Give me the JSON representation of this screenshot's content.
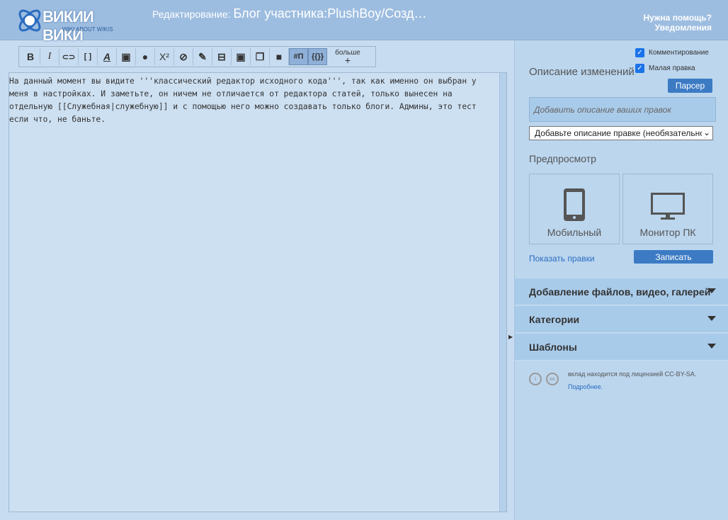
{
  "header": {
    "logo_text": "ВИКИИ ВИКИ",
    "logo_sub": "WIKI ABOUT WIKIS",
    "title_prefix": "Редактирование:",
    "title": "Блог участника:PlushBoy/Созд…",
    "help": "Нужна помощь?",
    "notifications": "Уведомления"
  },
  "toolbar": {
    "bold": "B",
    "italic": "I",
    "link": "⊂⊃",
    "brackets": "[ ]",
    "underline": "A",
    "image": "▣",
    "play": "●",
    "sup": "X²",
    "nowiki": "⊘",
    "sign": "✎",
    "hr": "⊟",
    "gallery_add": "▣",
    "gallery": "❐",
    "video": "■",
    "heading": "#П",
    "template": "{{}}",
    "more": "больше",
    "plus": "+"
  },
  "editor": {
    "content": "На данный момент вы видите '''классический редактор исходного кода''', так как именно он выбран у меня в настройках. И заметьте, он ничем не отличается от редактора статей, только вынесен на отдельную [[Служебная|служебную]] и с помощью него можно создавать только блоги. Админы, это тест если что, не баньте."
  },
  "right": {
    "comment_label": "Комментирование",
    "minor_label": "Малая правка",
    "summary_title": "Описание изменений",
    "parser": "Парсер",
    "summary_placeholder": "Добавить описание ваших правок",
    "summary_select": "Добавьте описание правке (необязательно)",
    "preview_title": "Предпросмотр",
    "mobile": "Мобильный",
    "desktop": "Монитор ПК",
    "show_changes": "Показать правки",
    "save": "Записать",
    "sections": [
      "Добавление файлов, видео, галерей",
      "Категории",
      "Шаблоны"
    ],
    "license": "вклад находится под лицензией CC-BY-SA.",
    "more_link": "Подробнее."
  }
}
